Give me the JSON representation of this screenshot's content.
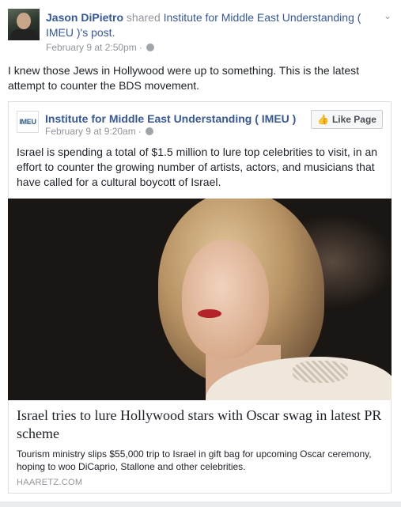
{
  "post": {
    "author": "Jason DiPietro",
    "verb": "shared",
    "shared_target": "Institute for Middle East Understanding ( IMEU )'s post.",
    "timestamp": "February 9 at 2:50pm",
    "separator": "·",
    "text": "I knew those Jews in Hollywood were up to something. This is the latest attempt to counter the BDS movement."
  },
  "shared_post": {
    "page_logo": "IMEU",
    "page_name": "Institute for Middle East Understanding ( IMEU )",
    "timestamp": "February 9 at 9:20am",
    "separator": "·",
    "like_button_label": "Like Page",
    "text": "Israel is spending a total of $1.5 million to lure top celebrities to visit, in an effort to counter the growing number of artists, actors, and musicians that have called for a cultural boycott of Israel."
  },
  "link": {
    "headline": "Israel tries to lure Hollywood stars with Oscar swag in latest PR scheme",
    "description": "Tourism ministry slips $55,000 trip to Israel in gift bag for upcoming Oscar ceremony, hoping to woo DiCaprio, Stallone and other celebrities.",
    "domain": "HAARETZ.COM"
  },
  "icons": {
    "chevron": "chevron-down-icon",
    "audience": "globe-icon",
    "like": "thumbs-up-icon"
  },
  "colors": {
    "link_blue": "#365899",
    "meta_gray": "#90949c",
    "text": "#1d2129",
    "background": "#e9ebee"
  }
}
